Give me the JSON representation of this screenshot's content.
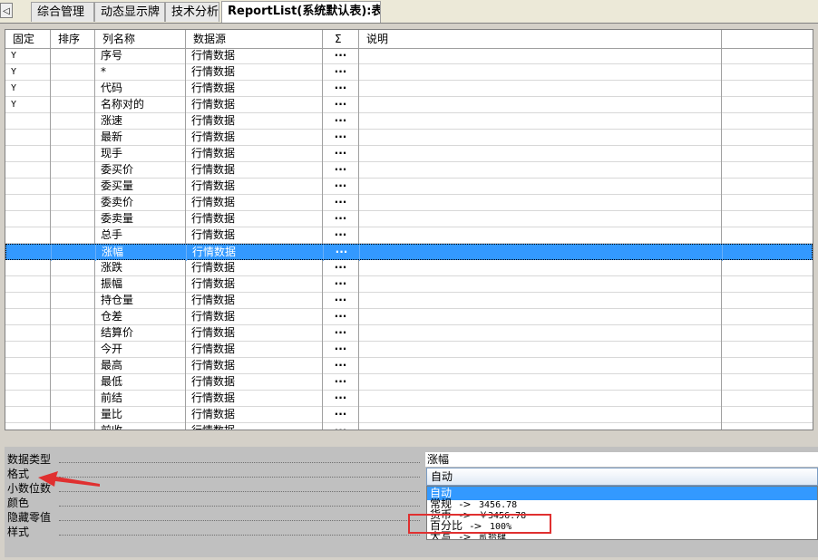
{
  "tabs": {
    "scroll_left": "◁",
    "items": [
      {
        "label": "综合管理"
      },
      {
        "label": "动态显示牌"
      },
      {
        "label": "技术分析"
      },
      {
        "label": "ReportList(系统默认表):表"
      }
    ]
  },
  "grid": {
    "headers": [
      "固定",
      "排序",
      "列名称",
      "数据源",
      "Σ",
      "说明"
    ],
    "rows": [
      {
        "fixed": "Y",
        "sort": "",
        "name": "序号",
        "source": "行情数据",
        "sum": "···",
        "desc": ""
      },
      {
        "fixed": "Y",
        "sort": "",
        "name": "*",
        "source": "行情数据",
        "sum": "···",
        "desc": ""
      },
      {
        "fixed": "Y",
        "sort": "",
        "name": "代码",
        "source": "行情数据",
        "sum": "···",
        "desc": ""
      },
      {
        "fixed": "Y",
        "sort": "",
        "name": "名称对的",
        "source": "行情数据",
        "sum": "···",
        "desc": ""
      },
      {
        "fixed": "",
        "sort": "",
        "name": "涨速",
        "source": "行情数据",
        "sum": "···",
        "desc": ""
      },
      {
        "fixed": "",
        "sort": "",
        "name": "最新",
        "source": "行情数据",
        "sum": "···",
        "desc": ""
      },
      {
        "fixed": "",
        "sort": "",
        "name": "现手",
        "source": "行情数据",
        "sum": "···",
        "desc": ""
      },
      {
        "fixed": "",
        "sort": "",
        "name": "委买价",
        "source": "行情数据",
        "sum": "···",
        "desc": ""
      },
      {
        "fixed": "",
        "sort": "",
        "name": "委买量",
        "source": "行情数据",
        "sum": "···",
        "desc": ""
      },
      {
        "fixed": "",
        "sort": "",
        "name": "委卖价",
        "source": "行情数据",
        "sum": "···",
        "desc": ""
      },
      {
        "fixed": "",
        "sort": "",
        "name": "委卖量",
        "source": "行情数据",
        "sum": "···",
        "desc": ""
      },
      {
        "fixed": "",
        "sort": "",
        "name": "总手",
        "source": "行情数据",
        "sum": "···",
        "desc": ""
      },
      {
        "fixed": "",
        "sort": "",
        "name": "涨幅",
        "source": "行情数据",
        "sum": "···",
        "desc": "",
        "selected": true
      },
      {
        "fixed": "",
        "sort": "",
        "name": "涨跌",
        "source": "行情数据",
        "sum": "···",
        "desc": ""
      },
      {
        "fixed": "",
        "sort": "",
        "name": "振幅",
        "source": "行情数据",
        "sum": "···",
        "desc": ""
      },
      {
        "fixed": "",
        "sort": "",
        "name": "持仓量",
        "source": "行情数据",
        "sum": "···",
        "desc": ""
      },
      {
        "fixed": "",
        "sort": "",
        "name": "仓差",
        "source": "行情数据",
        "sum": "···",
        "desc": ""
      },
      {
        "fixed": "",
        "sort": "",
        "name": "结算价",
        "source": "行情数据",
        "sum": "···",
        "desc": ""
      },
      {
        "fixed": "",
        "sort": "",
        "name": "今开",
        "source": "行情数据",
        "sum": "···",
        "desc": ""
      },
      {
        "fixed": "",
        "sort": "",
        "name": "最高",
        "source": "行情数据",
        "sum": "···",
        "desc": ""
      },
      {
        "fixed": "",
        "sort": "",
        "name": "最低",
        "source": "行情数据",
        "sum": "···",
        "desc": ""
      },
      {
        "fixed": "",
        "sort": "",
        "name": "前结",
        "source": "行情数据",
        "sum": "···",
        "desc": ""
      },
      {
        "fixed": "",
        "sort": "",
        "name": "量比",
        "source": "行情数据",
        "sum": "···",
        "desc": ""
      },
      {
        "fixed": "",
        "sort": "",
        "name": "前收",
        "source": "行情数据",
        "sum": "···",
        "desc": ""
      }
    ]
  },
  "properties": {
    "labels": [
      "数据类型",
      "格式",
      "小数位数",
      "颜色",
      "隐藏零值",
      "样式"
    ],
    "data_type_value": "涨幅",
    "format_value": "自动",
    "format_options": [
      {
        "label": "自动",
        "arrow": "",
        "example": ""
      },
      {
        "label": "常规",
        "arrow": "->",
        "example": "3456.78"
      },
      {
        "label": "货币",
        "arrow": "->",
        "example": "￥3456.78"
      },
      {
        "label": "百分比",
        "arrow": "->",
        "example": "100%"
      },
      {
        "label": "大写",
        "arrow": "->",
        "example": "贰拾肆"
      }
    ]
  },
  "annotations": {
    "arrow_color": "#e03030",
    "box_color": "#e03030"
  }
}
